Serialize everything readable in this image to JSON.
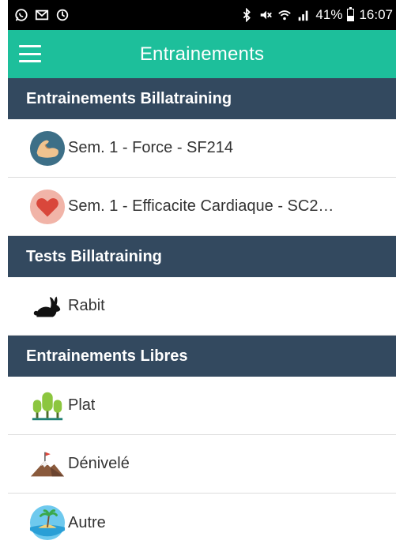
{
  "status_bar": {
    "left_icons": [
      "whatsapp-icon",
      "mail-icon",
      "sync-icon"
    ],
    "right_icons": [
      "bluetooth-icon",
      "mute-icon",
      "wifi-icon",
      "signal-icon"
    ],
    "battery": "41%",
    "time": "16:07"
  },
  "app_bar": {
    "title": "Entrainements",
    "background": "#1dbf9b"
  },
  "sections": [
    {
      "title": "Entrainements Billatraining",
      "items": [
        {
          "label": "Sem. 1 - Force - SF214",
          "icon": "muscle-icon"
        },
        {
          "label": "Sem. 1 - Efficacite Cardiaque - SC2…",
          "icon": "heart-icon"
        }
      ]
    },
    {
      "title": "Tests Billatraining",
      "items": [
        {
          "label": "Rabit",
          "icon": "rabbit-icon"
        }
      ]
    },
    {
      "title": "Entrainements Libres",
      "items": [
        {
          "label": "Plat",
          "icon": "trees-icon"
        },
        {
          "label": "Dénivelé",
          "icon": "mountain-icon"
        },
        {
          "label": "Autre",
          "icon": "island-icon"
        }
      ]
    }
  ],
  "colors": {
    "section_header": "#33495f",
    "accent": "#1dbf9b"
  }
}
